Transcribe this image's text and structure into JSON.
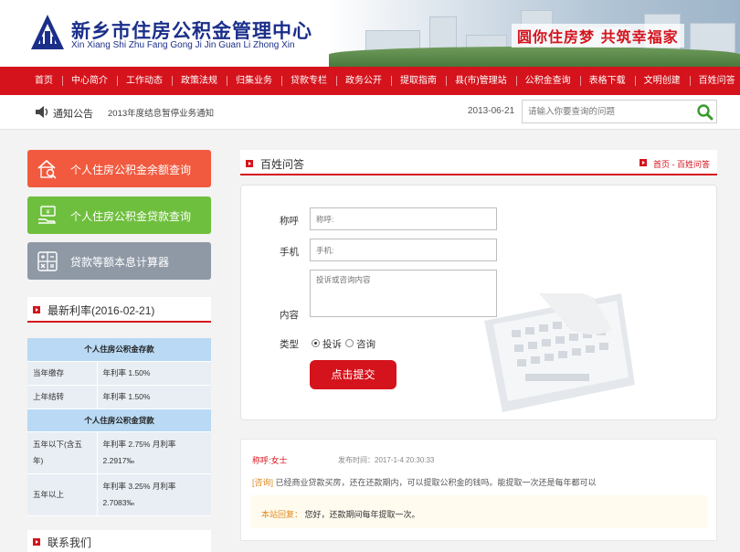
{
  "header": {
    "title_cn": "新乡市住房公积金管理中心",
    "title_en": "Xin Xiang Shi Zhu Fang Gong Ji Jin Guan Li Zhong Xin",
    "slogan": "圆你住房梦 共筑幸福家"
  },
  "nav": [
    "首页",
    "中心简介",
    "工作动态",
    "政策法规",
    "归集业务",
    "贷款专栏",
    "政务公开",
    "提取指南",
    "县(市)管理站",
    "公积金查询",
    "表格下载",
    "文明创建",
    "百姓问答"
  ],
  "notice": {
    "label": "通知公告",
    "text": "2013年度结息暂停业务通知",
    "date": "2013-06-21"
  },
  "search": {
    "placeholder": "请输入你要查询的问题"
  },
  "quick_buttons": [
    "个人住房公积金余额查询",
    "个人住房公积金贷款查询",
    "贷款等额本息计算器"
  ],
  "rates": {
    "title": "最新利率(2016-02-21)",
    "deposit_title": "个人住房公积金存款",
    "deposit_rows": [
      {
        "name": "当年缴存",
        "value": "年利率 1.50%"
      },
      {
        "name": "上年结转",
        "value": "年利率 1.50%"
      }
    ],
    "loan_title": "个人住房公积金贷款",
    "loan_rows": [
      {
        "name": "五年以下(含五年)",
        "value": "年利率 2.75% 月利率 2.2917‰"
      },
      {
        "name": "五年以上",
        "value": "年利率 3.25% 月利率 2.7083‰"
      }
    ]
  },
  "contact": {
    "title": "联系我们"
  },
  "qa": {
    "title": "百姓问答",
    "breadcrumb": "首页 - 百姓问答"
  },
  "form": {
    "name_label": "称呼",
    "name_placeholder": "称呼:",
    "phone_label": "手机",
    "phone_placeholder": "手机:",
    "content_label": "内容",
    "content_placeholder": "投诉或咨询内容",
    "type_label": "类型",
    "type_options": [
      "投诉",
      "咨询"
    ],
    "selected_type": "投诉",
    "submit_label": "点击提交"
  },
  "answer": {
    "name": "称呼:女士",
    "time": "发布时间：2017-1-4 20:30:33",
    "q_tag": "[咨询]",
    "question": "已经商业贷款买房，还在还款期内，可以提取公积金的钱吗。能提取一次还是每年都可以",
    "reply_tag": "本站回复：",
    "reply": "您好，还款期间每年提取一次。"
  },
  "colors": {
    "brand_red": "#d5131c",
    "navy": "#1b2f8a"
  }
}
